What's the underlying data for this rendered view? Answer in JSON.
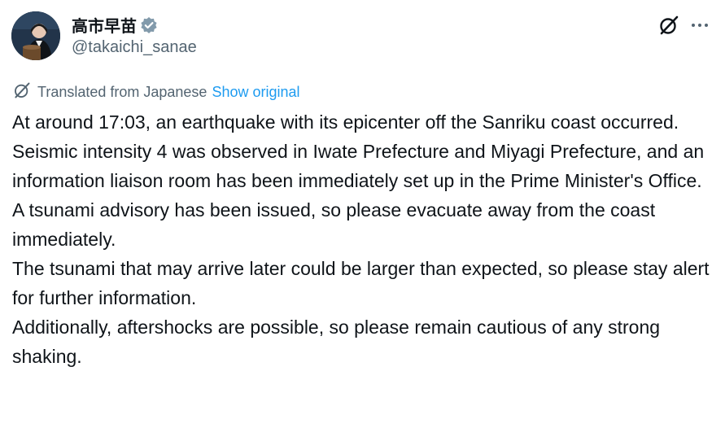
{
  "author": {
    "display_name": "高市早苗",
    "handle": "@takaichi_sanae",
    "verified_icon": "verified-badge-icon",
    "avatar_icon": "avatar"
  },
  "actions": {
    "grok_icon": "grok-icon",
    "more_icon": "more-icon"
  },
  "translation": {
    "label": "Translated from Japanese",
    "show_original": "Show original"
  },
  "tweet": {
    "lines": [
      "At around 17:03, an earthquake with its epicenter off the Sanriku coast occurred.",
      "Seismic intensity 4 was observed in Iwate Prefecture and Miyagi Prefecture, and an information liaison room has been immediately set up in the Prime Minister's Office.",
      "A tsunami advisory has been issued, so please evacuate away from the coast immediately.",
      "The tsunami that may arrive later could be larger than expected, so please stay alert for further information.",
      "Additionally, aftershocks are possible, so please remain cautious of any strong shaking."
    ]
  },
  "colors": {
    "link": "#1d9bf0",
    "muted": "#536471",
    "text": "#0f1419",
    "verified": "#829aab"
  }
}
